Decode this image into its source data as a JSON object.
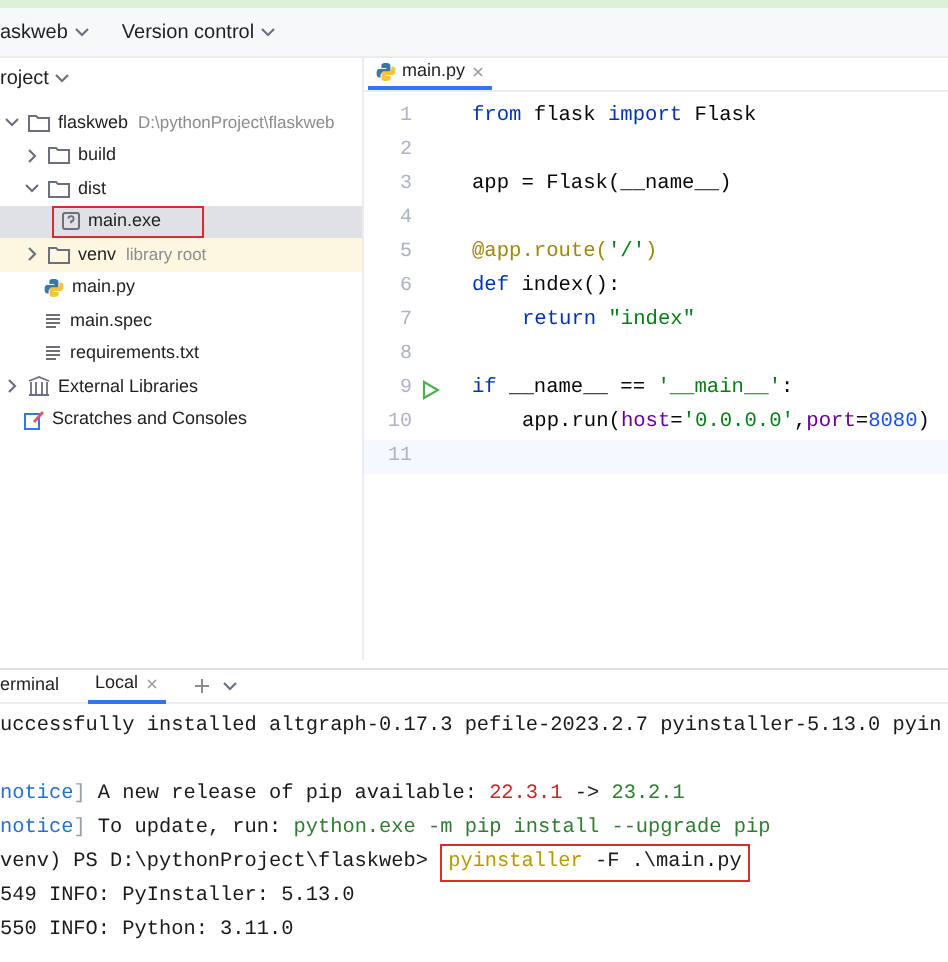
{
  "toolbar": {
    "project": "askweb",
    "vcs": "Version control"
  },
  "project_panel": {
    "title": "roject",
    "tree": [
      {
        "label": "flaskweb",
        "kind": "folder",
        "note": "D:\\pythonProject\\flaskweb",
        "expanded": true,
        "selected": false,
        "highlighted": false,
        "children": [
          {
            "label": "build",
            "kind": "folder",
            "expanded": false,
            "selected": false,
            "highlighted": false
          },
          {
            "label": "dist",
            "kind": "folder",
            "expanded": true,
            "selected": false,
            "highlighted": false,
            "children": [
              {
                "label": "main.exe",
                "kind": "exe",
                "selected": true,
                "highlighted": true
              }
            ]
          },
          {
            "label": "venv",
            "kind": "folder",
            "note": "library root",
            "excluded": true,
            "expanded": false,
            "selected": false,
            "highlighted": false
          },
          {
            "label": "main.py",
            "kind": "python",
            "selected": false,
            "highlighted": false
          },
          {
            "label": "main.spec",
            "kind": "text",
            "selected": false,
            "highlighted": false
          },
          {
            "label": "requirements.txt",
            "kind": "text",
            "selected": false,
            "highlighted": false
          }
        ]
      },
      {
        "label": "External Libraries",
        "kind": "library",
        "expanded": false,
        "selected": false,
        "highlighted": false
      },
      {
        "label": "Scratches and Consoles",
        "kind": "scratch",
        "selected": false,
        "highlighted": false
      }
    ]
  },
  "editor": {
    "tab": "main.py",
    "lines": [
      {
        "number": "1",
        "segments": [
          {
            "text": "from",
            "kind": "keyword"
          },
          {
            "text": " flask ",
            "kind": "plain"
          },
          {
            "text": "import",
            "kind": "keyword"
          },
          {
            "text": " Flask",
            "kind": "plain"
          }
        ]
      },
      {
        "number": "2"
      },
      {
        "number": "3",
        "segments": [
          {
            "text": "app = Flask(__name__)",
            "kind": "plain"
          }
        ]
      },
      {
        "number": "4"
      },
      {
        "number": "5",
        "segments": [
          {
            "text": "@app.route(",
            "kind": "decorator"
          },
          {
            "text": "'/'",
            "kind": "string"
          },
          {
            "text": ")",
            "kind": "decorator"
          }
        ]
      },
      {
        "number": "6",
        "segments": [
          {
            "text": "def",
            "kind": "keyword"
          },
          {
            "text": " index():",
            "kind": "plain"
          }
        ]
      },
      {
        "number": "7",
        "indent": true,
        "segments": [
          {
            "text": "return",
            "kind": "keyword"
          },
          {
            "text": " \"index\"",
            "kind": "string"
          }
        ]
      },
      {
        "number": "8"
      },
      {
        "number": "9",
        "run": true,
        "segments": [
          {
            "text": "if",
            "kind": "keyword"
          },
          {
            "text": " __name__ == ",
            "kind": "plain"
          },
          {
            "text": "'__main__'",
            "kind": "string"
          },
          {
            "text": ":",
            "kind": "plain"
          }
        ]
      },
      {
        "number": "10",
        "indent": true,
        "segments": [
          {
            "text": "app.run(",
            "kind": "plain"
          },
          {
            "text": "host",
            "kind": "param"
          },
          {
            "text": "=",
            "kind": "plain"
          },
          {
            "text": "'0.0.0.0'",
            "kind": "string"
          },
          {
            "text": ",",
            "kind": "plain"
          },
          {
            "text": "port",
            "kind": "param"
          },
          {
            "text": "=",
            "kind": "plain"
          },
          {
            "text": "8080",
            "kind": "number"
          },
          {
            "text": ")",
            "kind": "plain"
          }
        ]
      },
      {
        "number": "11",
        "current": true
      }
    ]
  },
  "terminal": {
    "title": "erminal",
    "tabs": [
      {
        "label": "Local",
        "selected": true
      }
    ],
    "lines": [
      {
        "segments": [
          {
            "text": "uccessfully installed altgraph-0.17.3 pefile-2023.2.7 pyinstaller-5.13.0 pyin",
            "kind": "plain"
          }
        ]
      },
      {
        "gap_before": true,
        "segments": [
          {
            "text": "notice",
            "kind": "notice"
          },
          {
            "text": "]",
            "kind": "bracket"
          },
          {
            "text": " A new release of pip available: ",
            "kind": "plain"
          },
          {
            "text": "22.3.1",
            "kind": "old"
          },
          {
            "text": " -> ",
            "kind": "plain"
          },
          {
            "text": "23.2.1",
            "kind": "new"
          }
        ]
      },
      {
        "segments": [
          {
            "text": "notice",
            "kind": "notice"
          },
          {
            "text": "]",
            "kind": "bracket"
          },
          {
            "text": " To update, run: ",
            "kind": "plain"
          },
          {
            "text": "python.exe -m pip install --upgrade pip",
            "kind": "new"
          }
        ]
      },
      {
        "segments": [
          {
            "text": "venv) PS D:\\pythonProject\\flaskweb> ",
            "kind": "plain"
          },
          {
            "text": "pyinstaller",
            "kind": "command",
            "highlighted": true
          },
          {
            "text": " -F .\\main.py",
            "kind": "plain",
            "highlighted": true
          }
        ]
      },
      {
        "segments": [
          {
            "text": "549 INFO: PyInstaller: 5.13.0",
            "kind": "plain"
          }
        ]
      },
      {
        "segments": [
          {
            "text": "550 INFO: Python: 3.11.0",
            "kind": "plain"
          }
        ]
      }
    ]
  }
}
